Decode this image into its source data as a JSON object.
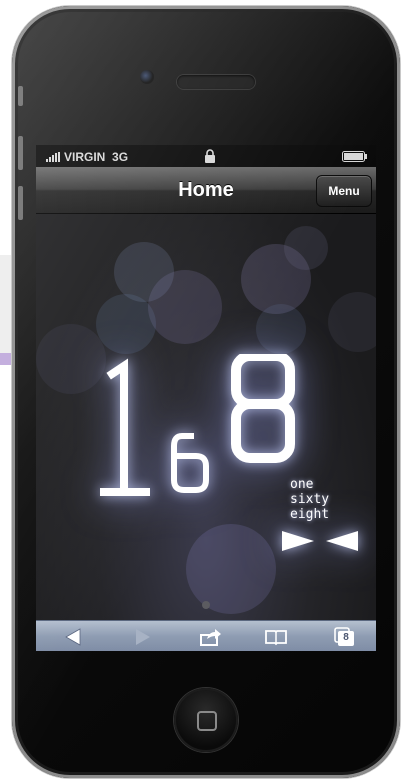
{
  "status_bar": {
    "carrier": "VIRGIN",
    "network": "3G"
  },
  "nav_bar": {
    "title": "Home",
    "menu_label": "Menu"
  },
  "logo": {
    "digit_one": "1",
    "digit_six": "6",
    "digit_eight": "8"
  },
  "tagline": [
    "one",
    "sixty",
    "eight"
  ],
  "toolbar": {
    "tabs_count": "8"
  },
  "colors": {
    "toolbar": "#8e9cb2",
    "navbar": "#2a2a2a",
    "glow": "#c8d2ff"
  },
  "icons": [
    "signal-icon",
    "lock-icon",
    "battery-icon",
    "bowtie-icon",
    "back-arrow-icon",
    "forward-arrow-icon",
    "share-icon",
    "bookmarks-icon",
    "tabs-icon",
    "home-button-icon"
  ]
}
